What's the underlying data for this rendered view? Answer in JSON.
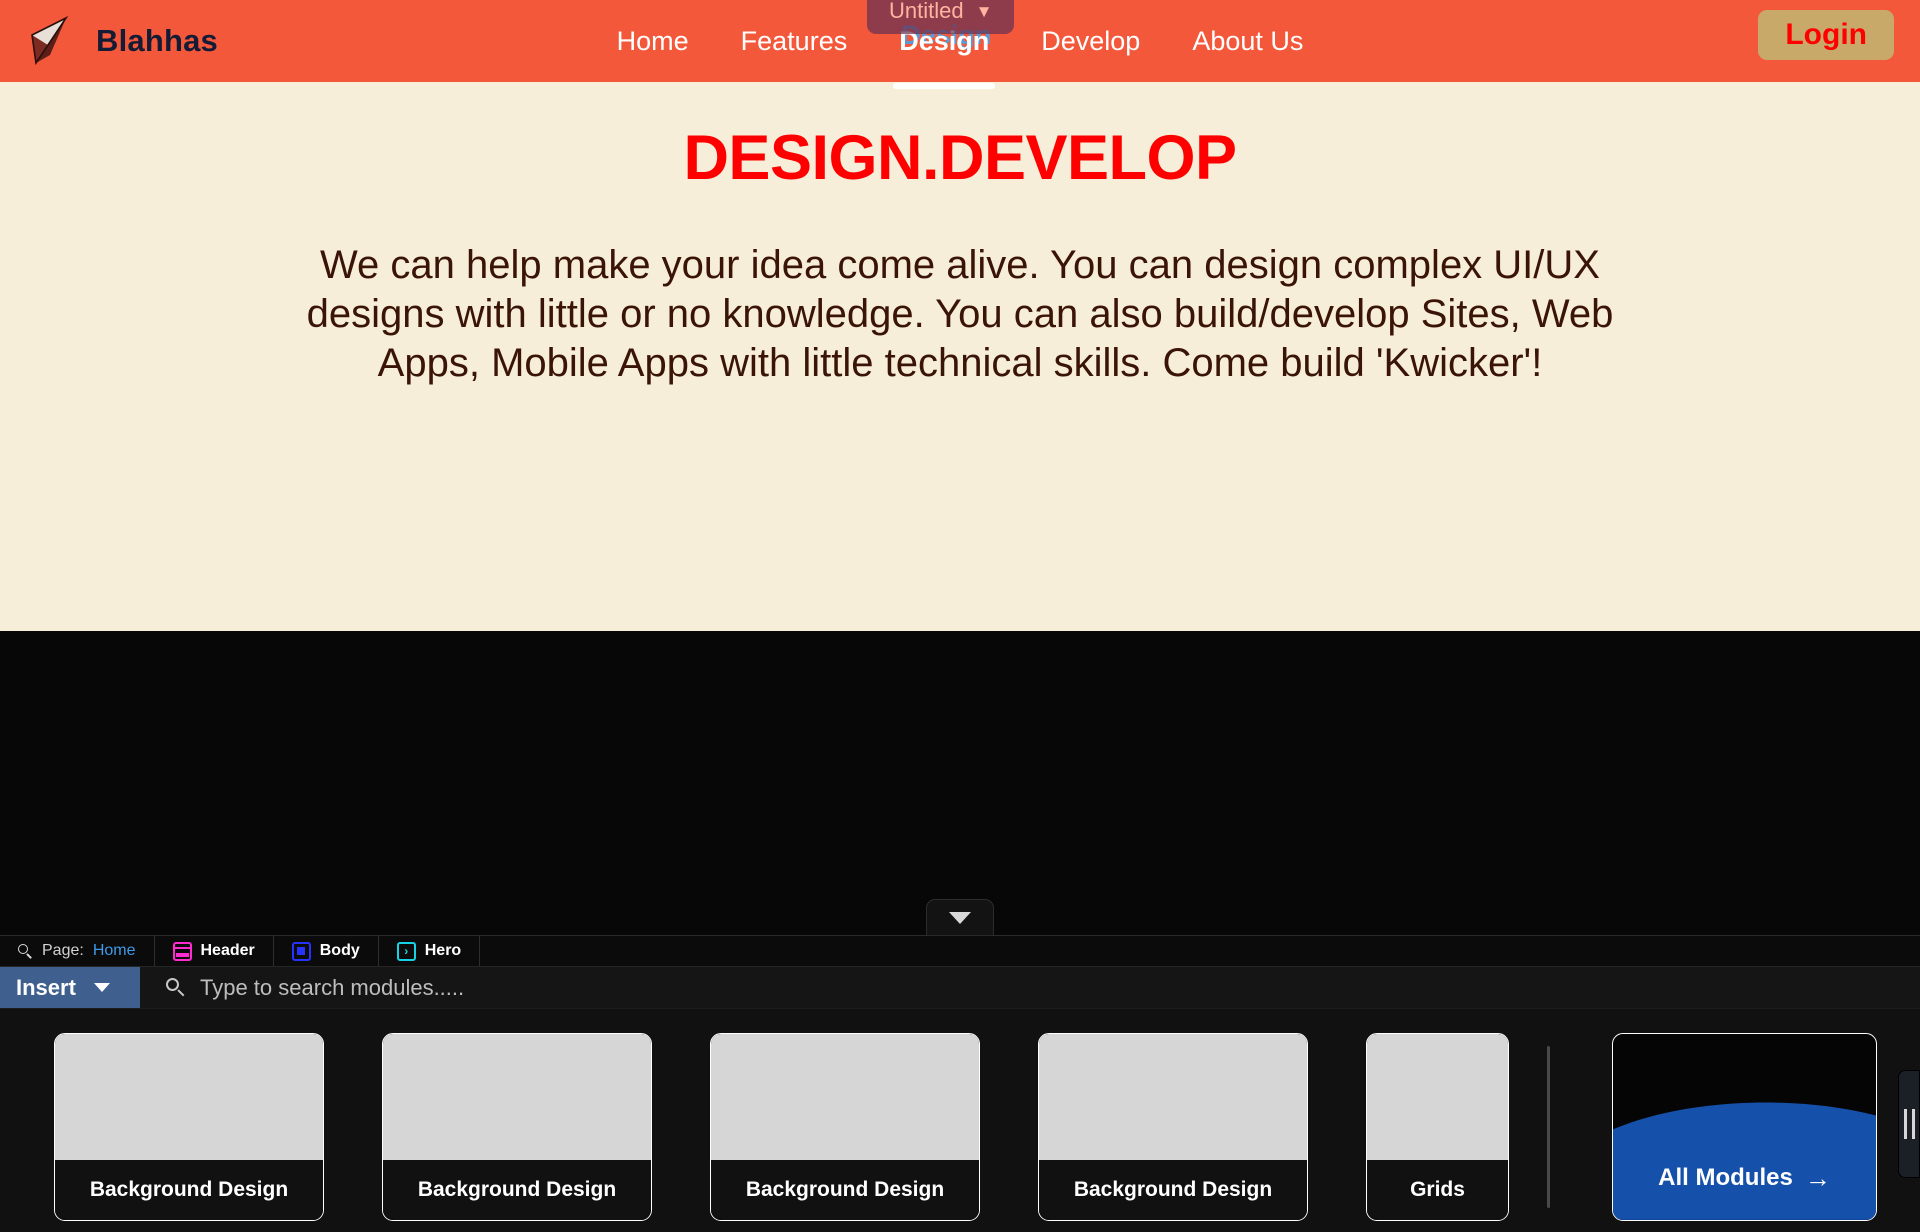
{
  "site": {
    "brand": {
      "name": "Blahhas",
      "logo_icon": "paper-plane-icon"
    },
    "nav": [
      {
        "label": "Home",
        "active": false
      },
      {
        "label": "Features",
        "active": false
      },
      {
        "label": "Design",
        "active": true
      },
      {
        "label": "Develop",
        "active": false
      },
      {
        "label": "About Us",
        "active": false
      }
    ],
    "login_label": "Login",
    "hero": {
      "title": "DESIGN.DEVELOP",
      "body": "We can help make your idea come alive. You can design complex UI/UX designs with little or no knowledge. You can also build/develop Sites, Web Apps, Mobile Apps with little technical skills. Come build 'Kwicker'!"
    },
    "colors": {
      "nav_bg": "#f4583a",
      "hero_bg": "#f6eed8",
      "hero_title": "#ff0000",
      "hero_body": "#3b1408",
      "login_bg": "#c9a96a",
      "login_text": "#ff0000",
      "dark_section": "#070707"
    }
  },
  "selection_chip": {
    "label": "Untitled",
    "chevron_icon": "chevron-down-icon",
    "bg": "#673252"
  },
  "canvas_collapse": {
    "icon": "triangle-down-icon"
  },
  "editor": {
    "breadcrumb": [
      {
        "name": "page",
        "prefix": "Page:",
        "value": "Home",
        "icon": "search-icon",
        "accent": "#3d9be9"
      },
      {
        "name": "header",
        "label": "Header",
        "icon": "header-layout-icon",
        "accent": "#ff2bd1"
      },
      {
        "name": "body",
        "label": "Body",
        "icon": "body-block-icon",
        "accent": "#2633ff"
      },
      {
        "name": "hero",
        "label": "Hero",
        "icon": "hero-arrow-icon",
        "accent": "#17d2e6"
      }
    ],
    "insert": {
      "label": "Insert",
      "caret_icon": "caret-down-icon",
      "bg": "#3f5f8f"
    },
    "search": {
      "placeholder": "Type to search modules.....",
      "value": "",
      "icon": "search-icon"
    },
    "modules": [
      {
        "label": "Background Design",
        "narrow": false
      },
      {
        "label": "Background Design",
        "narrow": false
      },
      {
        "label": "Background Design",
        "narrow": false
      },
      {
        "label": "Background Design",
        "narrow": false
      },
      {
        "label": "Grids",
        "narrow": true
      }
    ],
    "all_modules": {
      "label": "All Modules",
      "arrow_icon": "arrow-right-icon",
      "wave_color": "#1550ab"
    },
    "drag_handle": {
      "icon": "grip-vertical-icon"
    }
  }
}
